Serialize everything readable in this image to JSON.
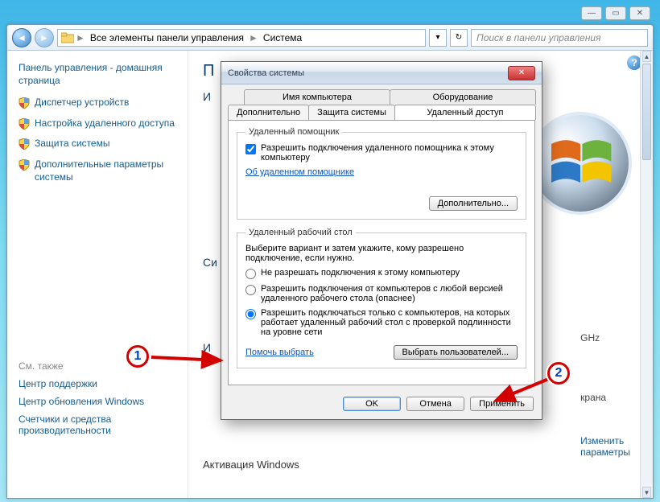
{
  "titlebar": {
    "min": "—",
    "max": "▭",
    "close": "✕"
  },
  "address": {
    "back_glyph": "◄",
    "fwd_glyph": "►",
    "crumb_root": "Все элементы панели управления",
    "crumb_leaf": "Система",
    "sep": "►",
    "dd_glyph": "▾",
    "refresh_glyph": "↻",
    "search_placeholder": "Поиск в панели управления"
  },
  "sidebar": {
    "home": "Панель управления - домашняя страница",
    "links": [
      "Диспетчер устройств",
      "Настройка удаленного доступа",
      "Защита системы",
      "Дополнительные параметры системы"
    ],
    "seealso_head": "См. также",
    "seealso": [
      "Центр поддержки",
      "Центр обновления Windows",
      "Счетчики и средства производительности"
    ]
  },
  "main": {
    "head_initial": "П",
    "sub1_initial": "И",
    "sub2_initial": "Си",
    "sub3_initial": "И",
    "ghz": "GHz",
    "krana": "крана",
    "change": "Изменить",
    "params": "параметры",
    "activation": "Активация Windows",
    "help_glyph": "?"
  },
  "dialog": {
    "title": "Свойства системы",
    "tabs_back": [
      "Имя компьютера",
      "Оборудование"
    ],
    "tabs_front": [
      "Дополнительно",
      "Защита системы",
      "Удаленный доступ"
    ],
    "assistant": {
      "legend": "Удаленный помощник",
      "checkbox": "Разрешить подключения удаленного помощника к этому компьютеру",
      "about": "Об удаленном помощнике",
      "advanced_btn": "Дополнительно..."
    },
    "rdp": {
      "legend": "Удаленный рабочий стол",
      "instr": "Выберите вариант и затем укажите, кому разрешено подключение, если нужно.",
      "opt1": "Не разрешать подключения к этому компьютеру",
      "opt2": "Разрешить подключения от компьютеров с любой версией удаленного рабочего стола (опаснее)",
      "opt3": "Разрешить подключаться только с компьютеров, на которых работает удаленный рабочий стол с проверкой подлинности на уровне сети",
      "help": "Помочь выбрать",
      "select_users": "Выбрать пользователей..."
    },
    "buttons": {
      "ok": "OK",
      "cancel": "Отмена",
      "apply": "Применить"
    },
    "close_glyph": "✕"
  },
  "annotations": {
    "n1": "1",
    "n2": "2"
  }
}
